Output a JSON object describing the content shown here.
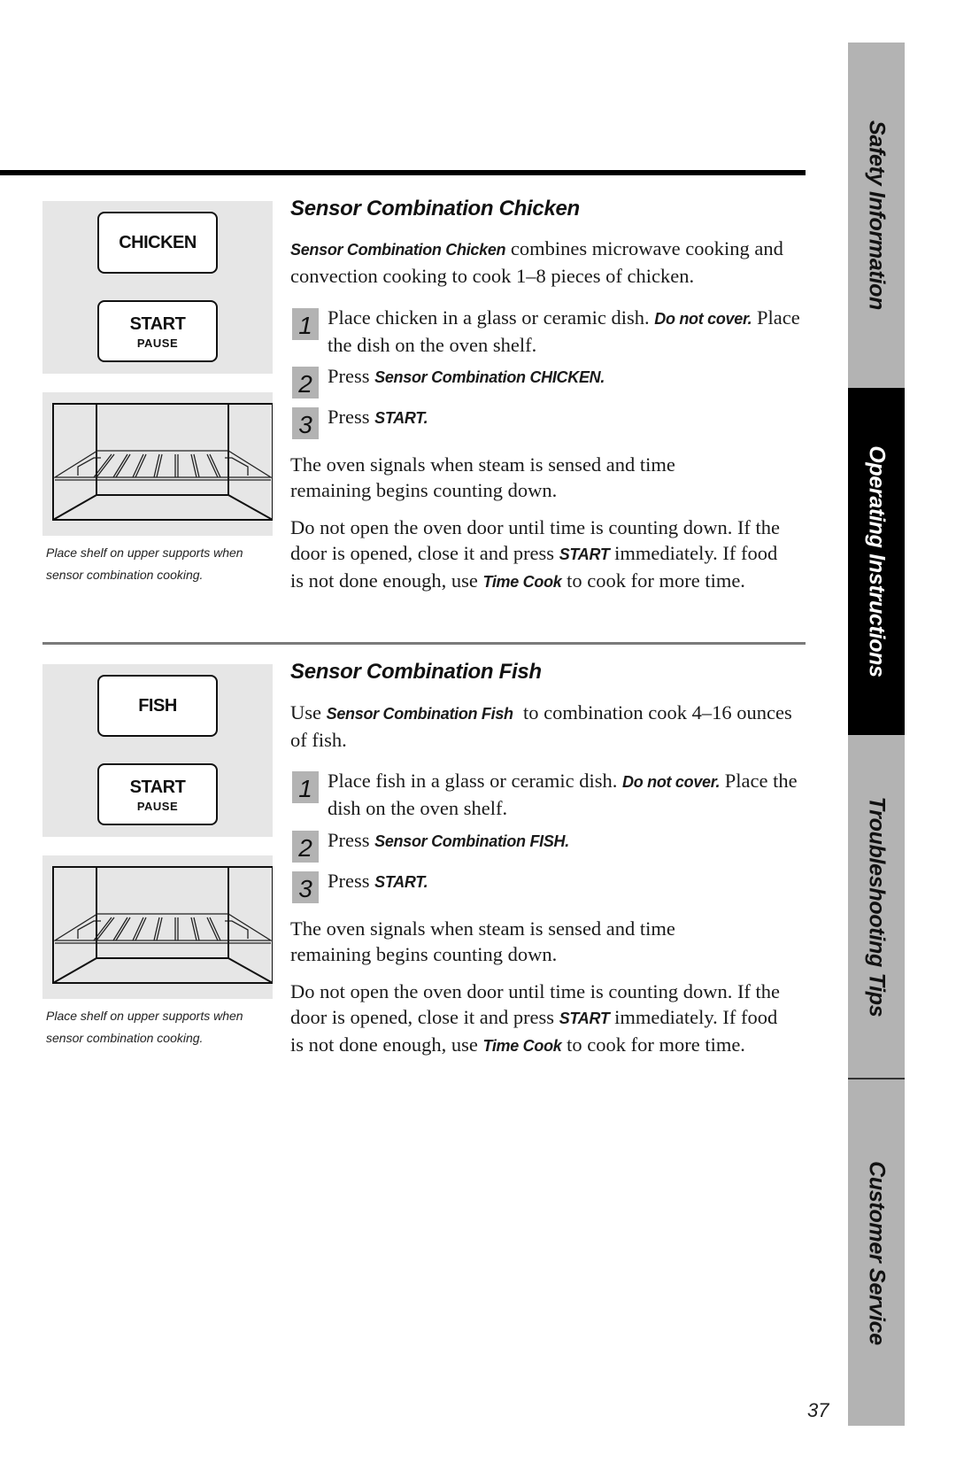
{
  "side_tabs": [
    {
      "label": "Safety Information",
      "active": false
    },
    {
      "label": "Operating Instructions",
      "active": true
    },
    {
      "label": "Troubleshooting Tips",
      "active": false
    },
    {
      "label": "Customer Service",
      "active": false
    }
  ],
  "colors": {
    "tab_inactive": "#b3b3b3",
    "tab_active": "#000000",
    "panel_bg": "#e6e6e6",
    "step_badge": "#b3b3b3"
  },
  "sections": [
    {
      "title": "Sensor Combination Chicken",
      "keypad": {
        "feature_key": "CHICKEN",
        "start_key": "START",
        "start_sub": "PAUSE"
      },
      "caption_line1": "Place shelf on upper supports when",
      "caption_line2": "sensor combination cooking.",
      "intro_bold": "Sensor Combination Chicken",
      "intro_rest": " combines microwave cooking and convection cooking to cook 1–8 pieces of chicken.",
      "steps": [
        {
          "num": "1",
          "text": "Place chicken in a glass or ceramic dish. ",
          "bold": "Do not cover.",
          "text2": " Place the dish on the oven shelf."
        },
        {
          "num": "2",
          "text": "Press ",
          "bold": "Sensor Combination CHICKEN.",
          "text2": ""
        },
        {
          "num": "3",
          "text": "Press ",
          "bold": "START.",
          "text2": ""
        }
      ],
      "signal_text": "The oven signals when steam is sensed and time remaining begins counting down.",
      "door_text_1": "Do not open the oven door until time is counting down. If the door is opened, close it and press ",
      "door_bold_1": "START",
      "door_text_2": " immediately. If food is not done enough, use ",
      "door_bold_2": "Time Cook",
      "door_text_3": " to cook for more time."
    },
    {
      "title": "Sensor Combination Fish",
      "keypad": {
        "feature_key": "FISH",
        "start_key": "START",
        "start_sub": "PAUSE"
      },
      "caption_line1": "Place shelf on upper supports when",
      "caption_line2": "sensor combination cooking.",
      "intro_pre": "Use ",
      "intro_bold": "Sensor Combination Fish",
      "intro_rest": "  to combination cook 4–16 ounces of fish.",
      "steps": [
        {
          "num": "1",
          "text": "Place fish in a glass or ceramic dish. ",
          "bold": "Do not cover.",
          "text2": " Place the dish on the oven shelf."
        },
        {
          "num": "2",
          "text": "Press ",
          "bold": "Sensor Combination FISH.",
          "text2": ""
        },
        {
          "num": "3",
          "text": "Press ",
          "bold": "START.",
          "text2": ""
        }
      ],
      "signal_text": "The oven signals when steam is sensed and time remaining begins counting down.",
      "door_text_1": "Do not open the oven door until time is counting down. If the door is opened, close it and press ",
      "door_bold_1": "START",
      "door_text_2": " immediately. If food is not done enough, use ",
      "door_bold_2": "Time Cook",
      "door_text_3": " to cook for more time."
    }
  ],
  "page_number": "37"
}
